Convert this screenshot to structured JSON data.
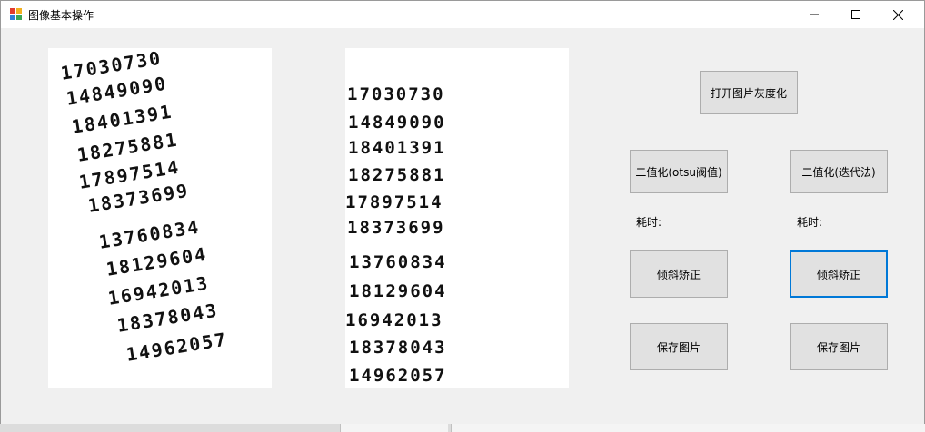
{
  "window": {
    "title": "图像基本操作"
  },
  "images": {
    "original": {
      "lines": [
        "17030730",
        "14849090",
        "18401391",
        "18275881",
        "17897514",
        "18373699",
        "13760834",
        "18129604",
        "16942013",
        "18378043",
        "14962057"
      ]
    },
    "corrected": {
      "lines": [
        "17030730",
        "14849090",
        "18401391",
        "18275881",
        "17897514",
        "18373699",
        "13760834",
        "18129604",
        "16942013",
        "18378043",
        "14962057"
      ]
    }
  },
  "buttons": {
    "open_gray": "打开图片灰度化",
    "binarize_otsu": "二值化(otsu阀值)",
    "binarize_iter": "二值化(迭代法)",
    "deskew_left": "倾斜矫正",
    "deskew_right": "倾斜矫正",
    "save_left": "保存图片",
    "save_right": "保存图片"
  },
  "labels": {
    "time_left": "耗时:",
    "time_right": "耗时:"
  }
}
